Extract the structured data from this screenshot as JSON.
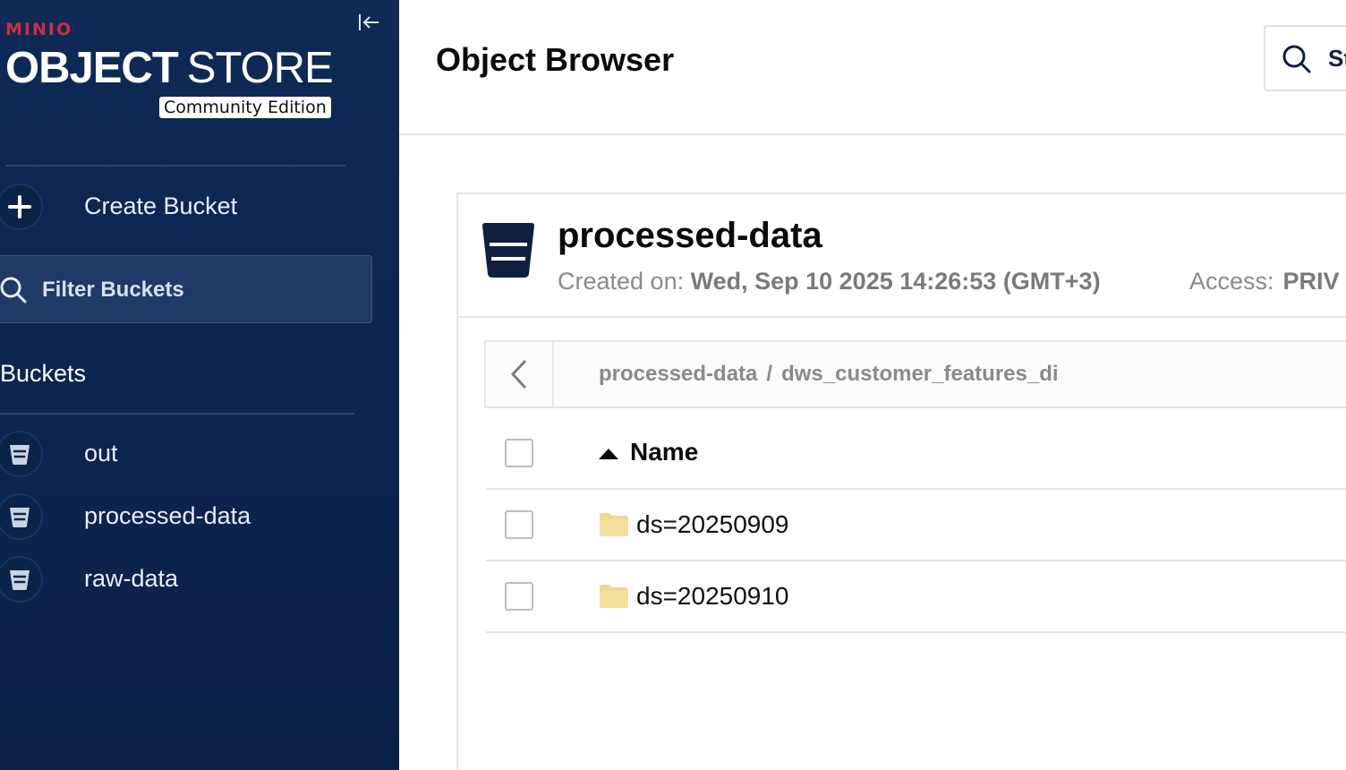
{
  "brand": {
    "logo_text": "MINIO",
    "product_bold": "OBJECT",
    "product_light": "STORE",
    "edition": "Community Edition"
  },
  "sidebar": {
    "create_bucket_label": "Create Bucket",
    "filter_placeholder": "Filter Buckets",
    "buckets_heading": "Buckets",
    "buckets": [
      {
        "label": "out",
        "icon": "bucket-icon"
      },
      {
        "label": "processed-data",
        "icon": "bucket-icon"
      },
      {
        "label": "raw-data",
        "icon": "bucket-icon"
      }
    ]
  },
  "header": {
    "title": "Object Browser",
    "search_placeholder": "St"
  },
  "bucket": {
    "name": "processed-data",
    "created_label": "Created on:",
    "created_value": "Wed, Sep 10 2025 14:26:53 (GMT+3)",
    "access_label": "Access:",
    "access_value": "PRIV"
  },
  "breadcrumb": {
    "parts": [
      "processed-data",
      "dws_customer_features_di"
    ],
    "separator": "/"
  },
  "table": {
    "name_header": "Name",
    "sort": "ascending",
    "rows": [
      {
        "name": "ds=20250909",
        "icon": "folder-icon"
      },
      {
        "name": "ds=20250910",
        "icon": "folder-icon"
      }
    ]
  },
  "colors": {
    "sidebar_bg": "#0e2a55",
    "brand_red": "#c8303d",
    "folder": "#f0d890",
    "bucket_icon_dark": "#0f1f3d"
  }
}
